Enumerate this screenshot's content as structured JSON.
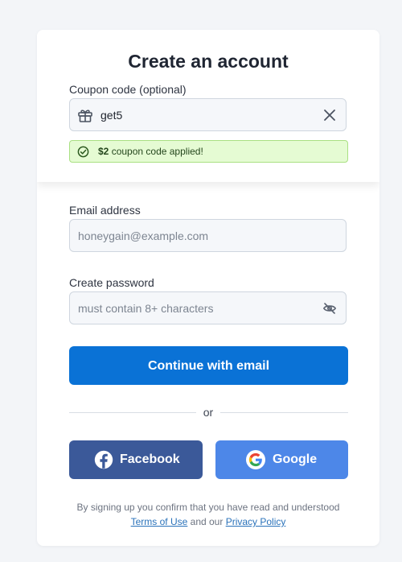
{
  "page": {
    "title": "Create an account"
  },
  "coupon": {
    "label": "Coupon code (optional)",
    "value": "get5",
    "gift_icon": "gift-icon",
    "clear_icon": "close-icon",
    "message_amount": "$2",
    "message_text": " coupon code applied!",
    "message_icon": "check-circle-icon",
    "success_bg": "#e5fbd3",
    "success_border": "#a9e083"
  },
  "email": {
    "label": "Email address",
    "placeholder": "honeygain@example.com",
    "value": ""
  },
  "password": {
    "label": "Create password",
    "placeholder": "must contain 8+ characters",
    "value": "",
    "toggle_icon": "eye-slash-icon"
  },
  "actions": {
    "continue_label": "Continue with email",
    "divider_text": "or",
    "facebook_label": "Facebook",
    "google_label": "Google"
  },
  "legal": {
    "intro": "By signing up you confirm that you have read and understood",
    "terms": "Terms of Use",
    "middle": " and our ",
    "privacy": "Privacy Policy"
  },
  "colors": {
    "primary": "#0a72d6",
    "facebook": "#3b5999",
    "google": "#4d87e8",
    "link": "#2a72ba"
  }
}
